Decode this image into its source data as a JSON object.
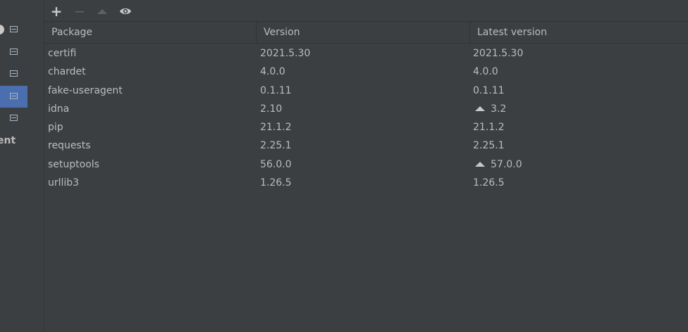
{
  "sidebar": {
    "partial_label": "ent",
    "items": [
      {
        "icon": "item-icon",
        "active": false
      },
      {
        "icon": "item-icon",
        "active": false
      },
      {
        "icon": "item-icon",
        "active": false
      },
      {
        "icon": "item-icon",
        "active": true
      },
      {
        "icon": "item-icon",
        "active": false
      }
    ]
  },
  "toolbar": {
    "add_label": "+",
    "remove_label": "−"
  },
  "table": {
    "columns": [
      "Package",
      "Version",
      "Latest version"
    ],
    "rows": [
      {
        "package": "certifi",
        "version": "2021.5.30",
        "latest": "2021.5.30",
        "upgrade": false
      },
      {
        "package": "chardet",
        "version": "4.0.0",
        "latest": "4.0.0",
        "upgrade": false
      },
      {
        "package": "fake-useragent",
        "version": "0.1.11",
        "latest": "0.1.11",
        "upgrade": false
      },
      {
        "package": "idna",
        "version": "2.10",
        "latest": "3.2",
        "upgrade": true
      },
      {
        "package": "pip",
        "version": "21.1.2",
        "latest": "21.1.2",
        "upgrade": false
      },
      {
        "package": "requests",
        "version": "2.25.1",
        "latest": "2.25.1",
        "upgrade": false
      },
      {
        "package": "setuptools",
        "version": "56.0.0",
        "latest": "57.0.0",
        "upgrade": true
      },
      {
        "package": "urllib3",
        "version": "1.26.5",
        "latest": "1.26.5",
        "upgrade": false
      }
    ]
  },
  "colors": {
    "background": "#3c3f41",
    "active_item": "#4b6eaf",
    "text": "#bbbbbb"
  }
}
